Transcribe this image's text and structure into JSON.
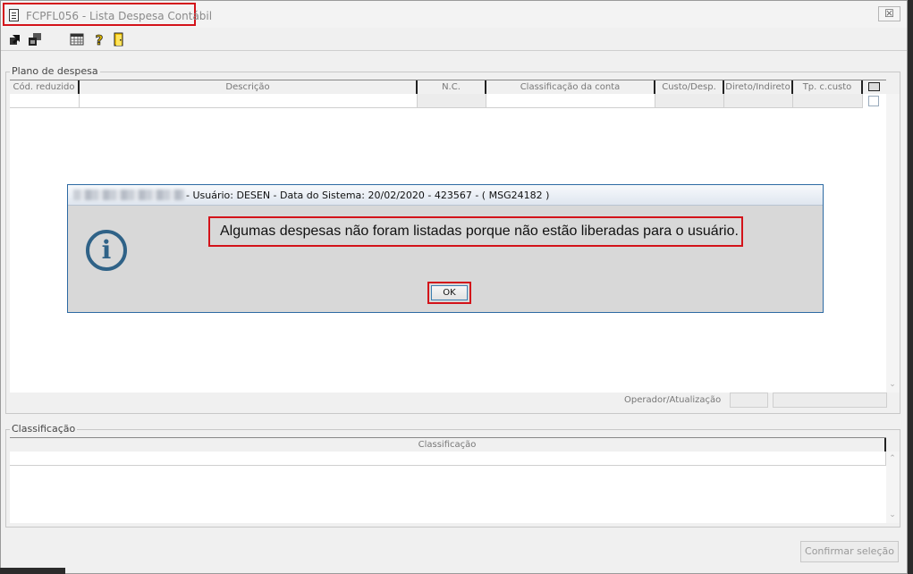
{
  "window": {
    "title": "FCPFL056 - Lista Despesa Contábil",
    "close_label": "☒"
  },
  "toolbar": {
    "buttons": [
      {
        "icon": "export-arrow-icon"
      },
      {
        "icon": "stack-windows-icon"
      },
      {
        "icon": "calendar-grid-icon"
      },
      {
        "icon": "help-icon",
        "glyph": "?"
      },
      {
        "icon": "exit-door-icon"
      }
    ]
  },
  "plano": {
    "group_label": "Plano de despesa",
    "columns": [
      "Cód. reduzido",
      "Descrição",
      "N.C.",
      "Classificação da conta",
      "Custo/Desp.",
      "Direto/Indireto",
      "Tp. c.custo"
    ],
    "operador_label": "Operador/Atualização"
  },
  "classificacao": {
    "group_label": "Classificação",
    "columns": [
      "Classificação"
    ]
  },
  "confirm_label": "Confirmar seleção",
  "dialog": {
    "title": "- Usuário: DESEN - Data do Sistema: 20/02/2020 - 423567 - ( MSG24182 )",
    "message": "Algumas despesas não foram listadas porque não estão liberadas para o usuário.",
    "icon_glyph": "i",
    "ok_label": "OK"
  },
  "colors": {
    "highlight": "#d3131a",
    "info_icon": "#2f6287",
    "dialog_border": "#2d6aa3"
  }
}
